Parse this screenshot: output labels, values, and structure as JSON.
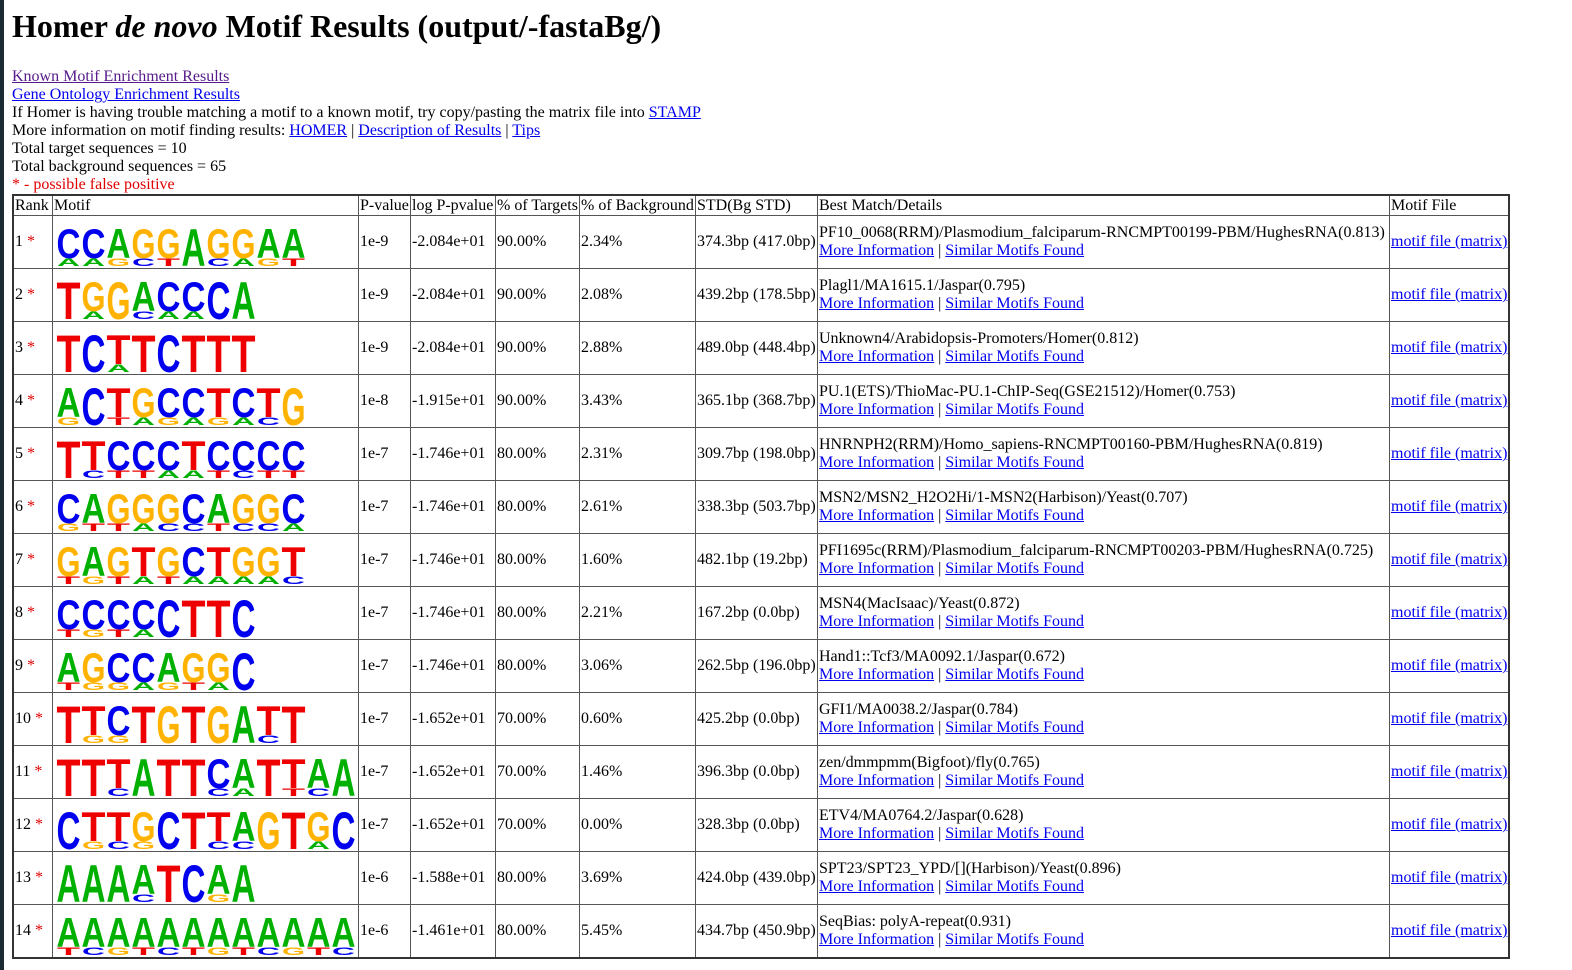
{
  "title": {
    "pre": "Homer ",
    "italic": "de novo",
    "post": " Motif Results (output/-fastaBg/)"
  },
  "links": {
    "known": "Known Motif Enrichment Results",
    "go": "Gene Ontology Enrichment Results"
  },
  "stamp_text": "If Homer is having trouble matching a motif to a known motif, try copy/pasting the matrix file into ",
  "stamp_link": "STAMP",
  "moreinfo": {
    "prefix": "More information on motif finding results: ",
    "homer": "HOMER",
    "sep": " | ",
    "desc": "Description of Results",
    "tips": "Tips"
  },
  "totals": {
    "target": "Total target sequences = 10",
    "background": "Total background sequences = 65"
  },
  "fp_note": "* - possible false positive",
  "headers": [
    "Rank",
    "Motif",
    "P-value",
    "log P-pvalue",
    "% of Targets",
    "% of Background",
    "STD(Bg STD)",
    "Best Match/Details",
    "Motif File"
  ],
  "star": "*",
  "more_info_label": "More Information",
  "similar_label": "Similar Motifs Found",
  "pipe": " | ",
  "motif_file_label": "motif file (matrix)",
  "base_colors": {
    "A": "#00b000",
    "C": "#0000ee",
    "G": "#ffb300",
    "T": "#ee0000"
  },
  "rows": [
    {
      "rank": "1",
      "motif": "CCAGGAGGAA",
      "sub": [
        "A",
        "A",
        "G",
        "C",
        "T",
        "",
        "C",
        "A",
        "G",
        "T"
      ],
      "pvalue": "1e-9",
      "logp": "-2.084e+01",
      "targets": "90.00%",
      "background": "2.34%",
      "std": "374.3bp (417.0bp)",
      "match": "PF10_0068(RRM)/Plasmodium_falciparum-RNCMPT00199-PBM/HughesRNA(0.813)"
    },
    {
      "rank": "2",
      "motif": "TGGACCCA",
      "sub": [
        "",
        "A",
        "",
        "C",
        "A",
        "A",
        "",
        ""
      ],
      "pvalue": "1e-9",
      "logp": "-2.084e+01",
      "targets": "90.00%",
      "background": "2.08%",
      "std": "439.2bp (178.5bp)",
      "match": "Plagl1/MA1615.1/Jaspar(0.795)"
    },
    {
      "rank": "3",
      "motif": "TCTTCTTT",
      "sub": [
        "",
        "",
        "A",
        "",
        "",
        "",
        "",
        ""
      ],
      "pvalue": "1e-9",
      "logp": "-2.084e+01",
      "targets": "90.00%",
      "background": "2.88%",
      "std": "489.0bp (448.4bp)",
      "match": "Unknown4/Arabidopsis-Promoters/Homer(0.812)"
    },
    {
      "rank": "4",
      "motif": "ACTGCCTCTG",
      "sub": [
        "G",
        "",
        "T",
        "A",
        "G",
        "A",
        "G",
        "A",
        "C",
        ""
      ],
      "pvalue": "1e-8",
      "logp": "-1.915e+01",
      "targets": "90.00%",
      "background": "3.43%",
      "std": "365.1bp (368.7bp)",
      "match": "PU.1(ETS)/ThioMac-PU.1-ChIP-Seq(GSE21512)/Homer(0.753)"
    },
    {
      "rank": "5",
      "motif": "TTCCCTCCCC",
      "sub": [
        "",
        "C",
        "T",
        "T",
        "A",
        "A",
        "T",
        "C",
        "T",
        "T"
      ],
      "pvalue": "1e-7",
      "logp": "-1.746e+01",
      "targets": "80.00%",
      "background": "2.31%",
      "std": "309.7bp (198.0bp)",
      "match": "HNRNPH2(RRM)/Homo_sapiens-RNCMPT00160-PBM/HughesRNA(0.819)"
    },
    {
      "rank": "6",
      "motif": "CAGGGCAGGC",
      "sub": [
        "G",
        "T",
        "T",
        "A",
        "C",
        "C",
        "T",
        "C",
        "C",
        "A"
      ],
      "pvalue": "1e-7",
      "logp": "-1.746e+01",
      "targets": "80.00%",
      "background": "2.61%",
      "std": "338.3bp (503.7bp)",
      "match": "MSN2/MSN2_H2O2Hi/1-MSN2(Harbison)/Yeast(0.707)"
    },
    {
      "rank": "7",
      "motif": "GAGTGCTGGT",
      "sub": [
        "T",
        "G",
        "T",
        "A",
        "T",
        "A",
        "A",
        "A",
        "A",
        "C"
      ],
      "pvalue": "1e-7",
      "logp": "-1.746e+01",
      "targets": "80.00%",
      "background": "1.60%",
      "std": "482.1bp (19.2bp)",
      "match": "PFI1695c(RRM)/Plasmodium_falciparum-RNCMPT00203-PBM/HughesRNA(0.725)"
    },
    {
      "rank": "8",
      "motif": "CCCCCTTC",
      "sub": [
        "T",
        "G",
        "T",
        "A",
        "",
        "",
        "",
        ""
      ],
      "pvalue": "1e-7",
      "logp": "-1.746e+01",
      "targets": "80.00%",
      "background": "2.21%",
      "std": "167.2bp (0.0bp)",
      "match": "MSN4(MacIsaac)/Yeast(0.872)"
    },
    {
      "rank": "9",
      "motif": "AGCCAGGC",
      "sub": [
        "T",
        "G",
        "G",
        "A",
        "G",
        "T",
        "A",
        ""
      ],
      "pvalue": "1e-7",
      "logp": "-1.746e+01",
      "targets": "80.00%",
      "background": "3.06%",
      "std": "262.5bp (196.0bp)",
      "match": "Hand1::Tcf3/MA0092.1/Jaspar(0.672)"
    },
    {
      "rank": "10",
      "motif": "TTCTGTGATT",
      "sub": [
        "",
        "G",
        "G",
        "",
        "",
        "",
        "",
        "",
        "C",
        ""
      ],
      "pvalue": "1e-7",
      "logp": "-1.652e+01",
      "targets": "70.00%",
      "background": "0.60%",
      "std": "425.2bp (0.0bp)",
      "match": "GFI1/MA0038.2/Jaspar(0.784)"
    },
    {
      "rank": "11",
      "motif": "TTTATTCATTAA",
      "sub": [
        "",
        "",
        "C",
        "",
        "",
        "",
        "C",
        "A",
        "",
        "T",
        "C",
        ""
      ],
      "pvalue": "1e-7",
      "logp": "-1.652e+01",
      "targets": "70.00%",
      "background": "1.46%",
      "std": "396.3bp (0.0bp)",
      "match": "zen/dmmpmm(Bigfoot)/fly(0.765)"
    },
    {
      "rank": "12",
      "motif": "CTTGCTTAGTGC",
      "sub": [
        "",
        "G",
        "C",
        "G",
        "",
        "",
        "C",
        "C",
        "",
        "",
        "A",
        ""
      ],
      "pvalue": "1e-7",
      "logp": "-1.652e+01",
      "targets": "70.00%",
      "background": "0.00%",
      "std": "328.3bp (0.0bp)",
      "match": "ETV4/MA0764.2/Jaspar(0.628)"
    },
    {
      "rank": "13",
      "motif": "AAAATCAA",
      "sub": [
        "",
        "",
        "",
        "C",
        "",
        "",
        "G",
        ""
      ],
      "pvalue": "1e-6",
      "logp": "-1.588e+01",
      "targets": "80.00%",
      "background": "3.69%",
      "std": "424.0bp (439.0bp)",
      "match": "SPT23/SPT23_YPD/[](Harbison)/Yeast(0.896)"
    },
    {
      "rank": "14",
      "motif": "AAAAAAAAAAAA",
      "sub": [
        "T",
        "C",
        "G",
        "T",
        "C",
        "T",
        "G",
        "T",
        "C",
        "G",
        "T",
        "C"
      ],
      "pvalue": "1e-6",
      "logp": "-1.461e+01",
      "targets": "80.00%",
      "background": "5.45%",
      "std": "434.7bp (450.9bp)",
      "match": "SeqBias: polyA-repeat(0.931)"
    }
  ]
}
